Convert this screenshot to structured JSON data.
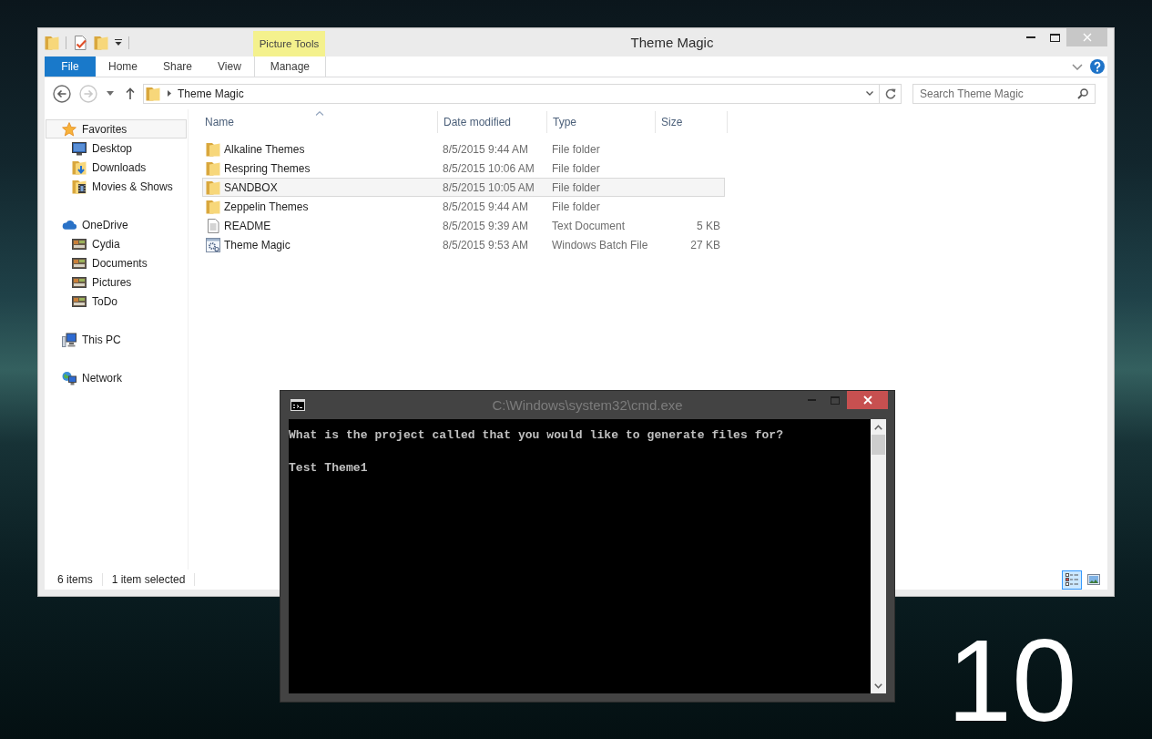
{
  "explorer": {
    "title": "Theme Magic",
    "tab_group": "Picture Tools",
    "tabs": [
      {
        "label": "File",
        "kind": "file",
        "selected": false
      },
      {
        "label": "Home",
        "kind": "standard",
        "selected": false
      },
      {
        "label": "Share",
        "kind": "standard",
        "selected": false
      },
      {
        "label": "View",
        "kind": "standard",
        "selected": false
      },
      {
        "label": "Manage",
        "kind": "contextual",
        "selected": false
      }
    ],
    "address": {
      "path": "Theme Magic"
    },
    "search": {
      "placeholder": "Search Theme Magic"
    },
    "nav": [
      {
        "label": "Favorites",
        "kind": "favorites",
        "selected": true,
        "children": [
          {
            "label": "Desktop",
            "kind": "desktop",
            "selected": false
          },
          {
            "label": "Downloads",
            "kind": "downloads",
            "selected": false
          },
          {
            "label": "Movies & Shows",
            "kind": "videos",
            "selected": false
          }
        ]
      },
      {
        "label": "OneDrive",
        "kind": "cloud",
        "selected": false,
        "children": [
          {
            "label": "Cydia",
            "kind": "picture-folder",
            "selected": false
          },
          {
            "label": "Documents",
            "kind": "picture-folder",
            "selected": false
          },
          {
            "label": "Pictures",
            "kind": "picture-folder",
            "selected": false
          },
          {
            "label": "ToDo",
            "kind": "picture-folder",
            "selected": false
          }
        ]
      },
      {
        "label": "This PC",
        "kind": "pc",
        "selected": false
      },
      {
        "label": "Network",
        "kind": "network",
        "selected": false
      }
    ],
    "columns": [
      {
        "label": "Name",
        "sorted": true
      },
      {
        "label": "Date modified",
        "sorted": false
      },
      {
        "label": "Type",
        "sorted": false
      },
      {
        "label": "Size",
        "sorted": false
      }
    ],
    "rows": [
      {
        "name": "Alkaline Themes",
        "date": "8/5/2015 9:44 AM",
        "type": "File folder",
        "kind": "folder",
        "selected": false
      },
      {
        "name": "Respring Themes",
        "date": "8/5/2015 10:06 AM",
        "type": "File folder",
        "kind": "folder",
        "selected": false
      },
      {
        "name": "SANDBOX",
        "date": "8/5/2015 10:05 AM",
        "type": "File folder",
        "kind": "folder",
        "selected": true
      },
      {
        "name": "Zeppelin Themes",
        "date": "8/5/2015 9:44 AM",
        "type": "File folder",
        "kind": "folder",
        "selected": false
      },
      {
        "name": "README",
        "date": "8/5/2015 9:39 AM",
        "type": "Text Document",
        "size": "5 KB",
        "kind": "text",
        "selected": false
      },
      {
        "name": "Theme Magic",
        "date": "8/5/2015 9:53 AM",
        "type": "Windows Batch File",
        "size": "27 KB",
        "kind": "batch",
        "selected": false
      }
    ],
    "status": {
      "count": "6 items",
      "selection": "1 item selected"
    },
    "views": [
      {
        "kind": "details",
        "selected": true
      },
      {
        "kind": "large-icons",
        "selected": false
      }
    ]
  },
  "console": {
    "title": "C:\\Windows\\system32\\cmd.exe",
    "prompt": "What is the project called that you would like to generate files for?",
    "input": "Test Theme1"
  },
  "desktop": {
    "widget_text": "10"
  }
}
